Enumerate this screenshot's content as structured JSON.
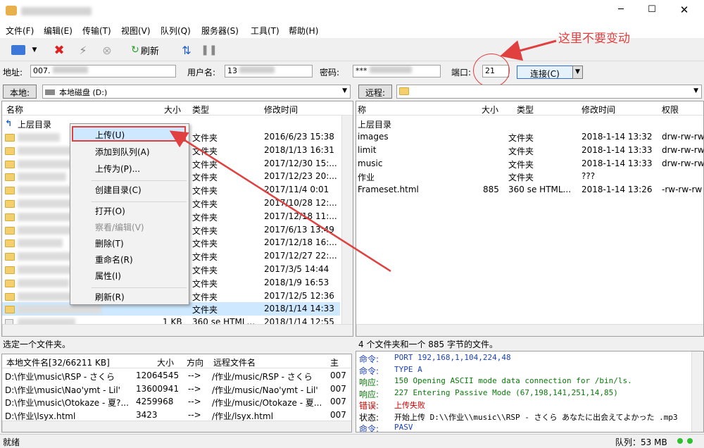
{
  "window": {
    "title_blurred": true,
    "controls": [
      "─",
      "☐",
      "✕"
    ]
  },
  "menu": [
    "文件(F)",
    "编辑(E)",
    "传输(T)",
    "视图(V)",
    "队列(Q)",
    "服务器(S)",
    "工具(T)",
    "帮助(H)"
  ],
  "toolbar": {
    "refresh_label": "刷新"
  },
  "annotation": {
    "note": "这里不要变动"
  },
  "connect": {
    "address_label": "地址:",
    "address_value": "007.",
    "user_label": "用户名:",
    "user_value": "13",
    "password_label": "密码:",
    "password_value": "***",
    "port_label": "端口:",
    "port_value": "21",
    "connect_button": "连接(C)"
  },
  "local": {
    "label": "本地:",
    "path": "本地磁盘 (D:)",
    "columns": [
      "名称",
      "大小",
      "类型",
      "修改时间"
    ],
    "parent": "上层目录",
    "rows": [
      {
        "type": "文件夹",
        "date": "2016/6/23 15:38"
      },
      {
        "type": "文件夹",
        "date": "2018/1/13 16:31"
      },
      {
        "type": "文件夹",
        "date": "2017/12/30 15:..."
      },
      {
        "type": "文件夹",
        "date": "2017/12/23 20:..."
      },
      {
        "type": "文件夹",
        "date": "2017/11/4 0:01"
      },
      {
        "type": "文件夹",
        "date": "2017/10/28 12:..."
      },
      {
        "type": "文件夹",
        "date": "2017/12/18 11:..."
      },
      {
        "type": "文件夹",
        "date": "2017/6/13 13:49"
      },
      {
        "type": "文件夹",
        "date": "2017/12/18 16:..."
      },
      {
        "type": "文件夹",
        "date": "2017/12/27 22:..."
      },
      {
        "type": "文件夹",
        "date": "2017/3/5 14:44"
      },
      {
        "type": "文件夹",
        "date": "2018/1/9 16:53"
      },
      {
        "type": "文件夹",
        "date": "2017/12/5 12:36"
      },
      {
        "type": "文件夹",
        "date": "2018/1/14 14:33"
      },
      {
        "size": "1 KB",
        "type": "360 se HTML...",
        "date": "2018/1/14 12:55"
      }
    ],
    "status": "选定一个文件夹。"
  },
  "remote": {
    "label": "远程:",
    "path": "",
    "columns": [
      "称",
      "大小",
      "类型",
      "修改时间",
      "权限"
    ],
    "parent": "上层目录",
    "rows": [
      {
        "name": "images",
        "size": "",
        "type": "文件夹",
        "date": "2018-1-14 13:32",
        "perm": "drw-rw-rw"
      },
      {
        "name": "limit",
        "size": "",
        "type": "文件夹",
        "date": "2018-1-14 13:33",
        "perm": "drw-rw-rw"
      },
      {
        "name": "music",
        "size": "",
        "type": "文件夹",
        "date": "2018-1-14 13:33",
        "perm": "drw-rw-rw"
      },
      {
        "name": "作业",
        "size": "",
        "type": "文件夹",
        "date": "???",
        "perm": ""
      },
      {
        "name": "Frameset.html",
        "size": "885",
        "type": "360 se HTML...",
        "date": "2018-1-14 13:26",
        "perm": "-rw-rw-rw"
      }
    ],
    "status": "4 个文件夹和一个 885 字节的文件。"
  },
  "context_menu": [
    "上传(U)",
    "添加到队列(A)",
    "上传为(P)...",
    "创建目录(C)",
    "打开(O)",
    "察看/编辑(V)",
    "删除(T)",
    "重命名(R)",
    "属性(I)",
    "刷新(R)"
  ],
  "queue": {
    "columns": [
      "本地文件名[32/66211 KB]",
      "大小",
      "方向",
      "远程文件名",
      "主"
    ],
    "rows": [
      {
        "local": "D:\\作业\\music\\RSP - さくら",
        "size": "12064545",
        "dir": "-->",
        "remote": "/作业/music/RSP - さくら",
        "extra": "007"
      },
      {
        "local": "D:\\作业\\music\\Nao'ymt - Lil'",
        "size": "13600941",
        "dir": "-->",
        "remote": "/作业/music/Nao'ymt - Lil'",
        "extra": "007"
      },
      {
        "local": "D:\\作业\\music\\Otokaze - 夏?...",
        "size": "4259968",
        "dir": "-->",
        "remote": "/作业/music/Otokaze - 夏...",
        "extra": "007"
      },
      {
        "local": "D:\\作业\\lsyx.html",
        "size": "3423",
        "dir": "-->",
        "remote": "/作业/lsyx.html",
        "extra": "007"
      }
    ]
  },
  "log": [
    {
      "k": "命令:",
      "v": "PORT 192,168,1,104,224,48",
      "c": "#1b3fbf"
    },
    {
      "k": "命令:",
      "v": "TYPE A",
      "c": "#1b3fbf"
    },
    {
      "k": "响应:",
      "v": "150 Opening ASCII mode data connection for /bin/ls.",
      "c": "#0a7a0a"
    },
    {
      "k": "响应:",
      "v": "227 Entering Passive Mode (67,198,141,251,14,85)",
      "c": "#0a7a0a"
    },
    {
      "k": "错误:",
      "v": "上传失败",
      "c": "#d00000"
    },
    {
      "k": "状态:",
      "v": "开始上传 D:\\\\作业\\\\music\\\\RSP - さくら あなたに出会えてよかった .mp3",
      "c": "#000000"
    },
    {
      "k": "命令:",
      "v": "PASV",
      "c": "#1b3fbf"
    }
  ],
  "statusbar": {
    "left": "就绪",
    "queue": "队列：53 MB"
  }
}
